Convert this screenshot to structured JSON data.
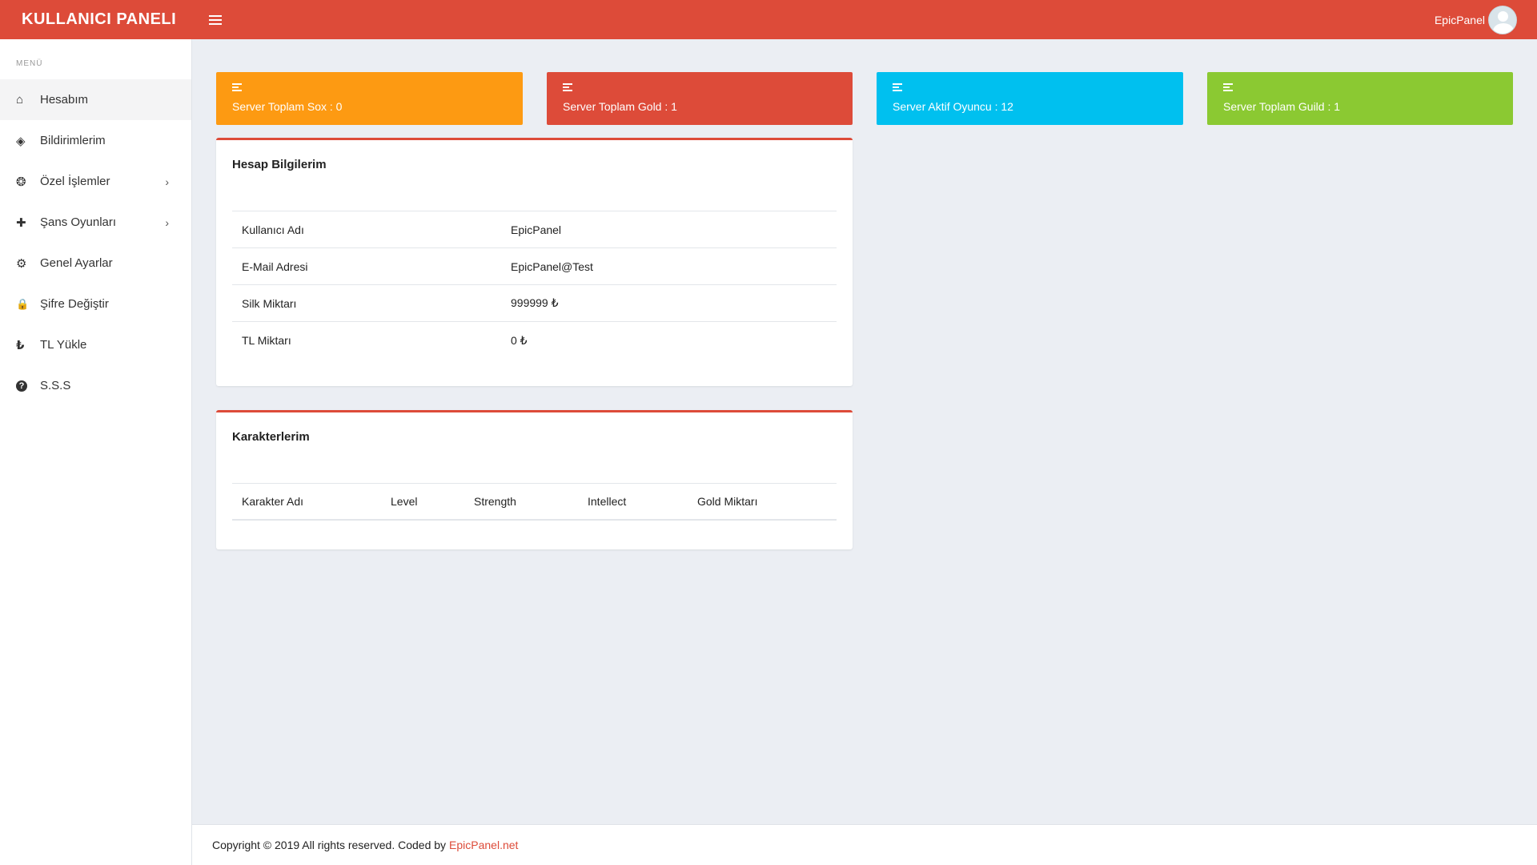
{
  "header": {
    "brand": "KULLANICI PANELI",
    "menu_toggle_icon": "hamburger-icon",
    "user_name": "EpicPanel",
    "avatar_icon": "user-avatar-icon",
    "bg_color": "#dd4b39"
  },
  "sidebar": {
    "title": "MENÜ",
    "items": [
      {
        "label": "Hesabım",
        "icon": "home-icon",
        "glyph": "⌂"
      },
      {
        "label": "Bildirimlerim",
        "icon": "tag-icon",
        "glyph": "◈"
      },
      {
        "label": "Özel İşlemler",
        "icon": "compass-icon",
        "glyph": "❂",
        "chevron": "›"
      },
      {
        "label": "Şans Oyunları",
        "icon": "puzzle-icon",
        "glyph": "✚",
        "chevron": "›"
      },
      {
        "label": "Genel Ayarlar",
        "icon": "gears-icon",
        "glyph": "⚙"
      },
      {
        "label": "Şifre Değiştir",
        "icon": "lock-icon",
        "glyph": "🔒"
      },
      {
        "label": "TL Yükle",
        "icon": "lira-icon",
        "glyph": "₺"
      },
      {
        "label": "S.S.S",
        "icon": "question-circle-icon",
        "glyph": "?"
      }
    ]
  },
  "stats": [
    {
      "label": "Server Toplam Sox : 0",
      "icon": "list-icon",
      "color": "#fd9a12"
    },
    {
      "label": "Server Toplam Gold : 1",
      "icon": "list-icon",
      "color": "#dd4b39"
    },
    {
      "label": "Server Aktif Oyuncu : 12",
      "icon": "list-icon",
      "color": "#00c0ef"
    },
    {
      "label": "Server Toplam Guild : 1",
      "icon": "list-icon",
      "color": "#8bc932"
    }
  ],
  "account": {
    "title": "Hesap Bilgilerim",
    "rows": [
      {
        "key": "Kullanıcı Adı",
        "value": "EpicPanel"
      },
      {
        "key": "E-Mail Adresi",
        "value": "EpicPanel@Test"
      },
      {
        "key": "Silk Miktarı",
        "value": "999999 ₺"
      },
      {
        "key": "TL Miktarı",
        "value": "0 ₺"
      }
    ]
  },
  "characters": {
    "title": "Karakterlerim",
    "columns": [
      "Karakter Adı",
      "Level",
      "Strength",
      "Intellect",
      "Gold Miktarı"
    ]
  },
  "footer": {
    "text": "Copyright © 2019 All rights reserved. Coded by",
    "link": "EpicPanel.net"
  }
}
